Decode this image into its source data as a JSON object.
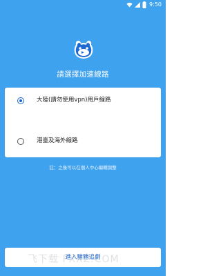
{
  "status_bar": {
    "time": "9:50",
    "icons": [
      "wifi-icon",
      "signal-icon",
      "battery-icon"
    ]
  },
  "logo": {
    "icon": "app-logo-icon"
  },
  "title": "請選擇加速線路",
  "options": [
    {
      "label": "大陸(請勿使用vpn)用戶線路",
      "selected": true
    },
    {
      "label": "港臺及海外線路",
      "selected": false
    }
  ],
  "note": "註：之後可以在個人中心編輯調整",
  "confirm_button": {
    "label": "進入豬豬追劇"
  },
  "watermark": "飞下载 FXXZ.COM",
  "colors": {
    "background": "#3fa2ee",
    "card": "#ffffff",
    "accent": "#1d66d0"
  }
}
